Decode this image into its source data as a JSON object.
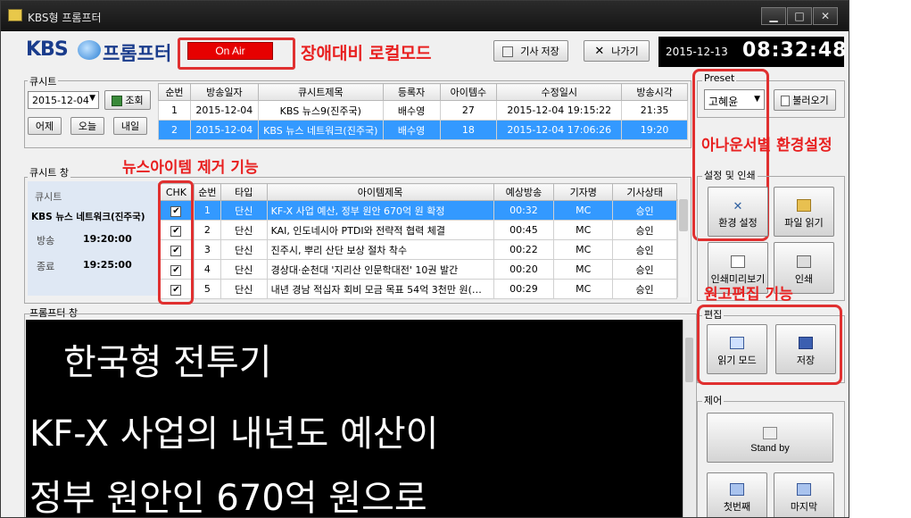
{
  "window": {
    "title": "KBS형 프롬프터",
    "controls": {
      "minimize": "▁",
      "maximize": "□",
      "close": "✕"
    }
  },
  "header": {
    "logo_kbs": "KBS",
    "logo_prompter": "프롬프터",
    "onair_label": "On Air",
    "annotation_local": "장애대비 로컬모드",
    "save_article": "기사 저장",
    "exit": "나가기",
    "date": "2015-12-13",
    "time": "08:32:48"
  },
  "cue_sheet": {
    "group_label": "큐시트",
    "date_value": "2015-12-04",
    "query": "조회",
    "yesterday": "어제",
    "today": "오늘",
    "tomorrow": "내일",
    "columns": [
      "순번",
      "방송일자",
      "큐시트제목",
      "등록자",
      "아이템수",
      "수정일시",
      "방송시각"
    ],
    "rows": [
      [
        "1",
        "2015-12-04",
        "KBS 뉴스9(진주국)",
        "배수영",
        "27",
        "2015-12-04 19:15:22",
        "21:35"
      ],
      [
        "2",
        "2015-12-04",
        "KBS 뉴스 네트워크(진주국)",
        "배수영",
        "18",
        "2015-12-04 17:06:26",
        "19:20"
      ]
    ],
    "selected_row": 1
  },
  "cue_window": {
    "group_label": "큐시트 창",
    "annotation": "뉴스아이템 제거 기능",
    "info": {
      "label": "큐시트",
      "program": "KBS 뉴스 네트워크(진주국)",
      "air_label": "방송",
      "air_time": "19:20:00",
      "end_label": "종료",
      "end_time": "19:25:00"
    },
    "columns": [
      "CHK",
      "순번",
      "타입",
      "아이템제목",
      "예상방송",
      "기자명",
      "기사상태"
    ],
    "rows": [
      [
        "✔",
        "1",
        "단신",
        "KF-X 사업 예산, 정부 원안 670억 원 확정",
        "00:32",
        "MC",
        "승인"
      ],
      [
        "✔",
        "2",
        "단신",
        "KAI, 인도네시아 PTDI와 전략적 협력 체결",
        "00:45",
        "MC",
        "승인"
      ],
      [
        "✔",
        "3",
        "단신",
        "진주시, 뿌리 산단 보상 절차 착수",
        "00:22",
        "MC",
        "승인"
      ],
      [
        "✔",
        "4",
        "단신",
        "경상대·순천대 '지리산 인문학대전' 10권 발간",
        "00:20",
        "MC",
        "승인"
      ],
      [
        "✔",
        "5",
        "단신",
        "내년 경남 적십자 회비 모금 목표 54억 3천만 원(…",
        "00:29",
        "MC",
        "승인"
      ]
    ],
    "selected_row": 0
  },
  "prompter": {
    "group_label": "프롬프터 창",
    "line1": "한국형 전투기",
    "line2": "KF-X 사업의 내년도 예산이",
    "line3": "정부 원안인 670억 원으로"
  },
  "right_panel": {
    "preset_label": "Preset",
    "preset_value": "고혜윤",
    "load": "불러오기",
    "annotation_env": "아나운서별 환경설정",
    "settings_group": "설정 및 인쇄",
    "env_settings": "환경 설정",
    "file_read": "파일 읽기",
    "print_preview": "인쇄미리보기",
    "print": "인쇄",
    "annotation_edit": "원고편집 기능",
    "edit_group": "편집",
    "read_mode": "읽기 모드",
    "save": "저장",
    "control_group": "제어",
    "standby": "Stand by",
    "first": "첫번째",
    "last": "마지막"
  },
  "colors": {
    "accent_red": "#e03030",
    "selection_blue": "#3399ff",
    "logo_blue": "#1a3c8c",
    "onair_red": "#e60000"
  }
}
